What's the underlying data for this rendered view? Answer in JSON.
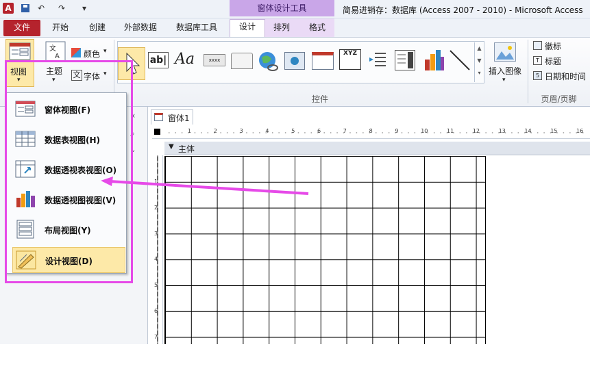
{
  "titlebar": {
    "app_icon": "A",
    "quick_access": [
      "save-icon",
      "undo-icon",
      "redo-icon",
      "customize-icon"
    ],
    "context_title": "窗体设计工具",
    "window_title": "简易进销存：数据库 (Access 2007 - 2010)  -  Microsoft Access"
  },
  "tabs": {
    "file": "文件",
    "items": [
      "开始",
      "创建",
      "外部数据",
      "数据库工具",
      "设计",
      "排列",
      "格式"
    ],
    "active": "设计"
  },
  "ribbon": {
    "view": {
      "label": "视图"
    },
    "theme": {
      "label": "主题",
      "color": "颜色",
      "font": "字体"
    },
    "controls_group": "控件",
    "insert_image": "插入图像",
    "header_footer": {
      "logo": "徽标",
      "title": "标题",
      "datetime": "日期和时间",
      "group": "页眉/页脚"
    }
  },
  "document": {
    "tab_label": "窗体1",
    "section_label": "主体",
    "ruler_numbers": [
      "1",
      "2",
      "3",
      "4",
      "5",
      "6",
      "7",
      "8",
      "9",
      "10",
      "11",
      "12",
      "13",
      "14",
      "15",
      "16"
    ],
    "vruler_numbers": [
      "1",
      "2",
      "3",
      "4",
      "5",
      "6",
      "7"
    ]
  },
  "view_menu": {
    "items": [
      {
        "label": "窗体视图(F)",
        "icon": "form-view-icon"
      },
      {
        "label": "数据表视图(H)",
        "icon": "datasheet-view-icon"
      },
      {
        "label": "数据透视表视图(O)",
        "icon": "pivot-table-view-icon"
      },
      {
        "label": "数据透视图视图(V)",
        "icon": "pivot-chart-view-icon"
      },
      {
        "label": "布局视图(Y)",
        "icon": "layout-view-icon"
      },
      {
        "label": "设计视图(D)",
        "icon": "design-view-icon"
      }
    ]
  },
  "colors": {
    "accent": "#e64ae8",
    "file_tab": "#b5232d",
    "context": "#c9a6e8"
  }
}
